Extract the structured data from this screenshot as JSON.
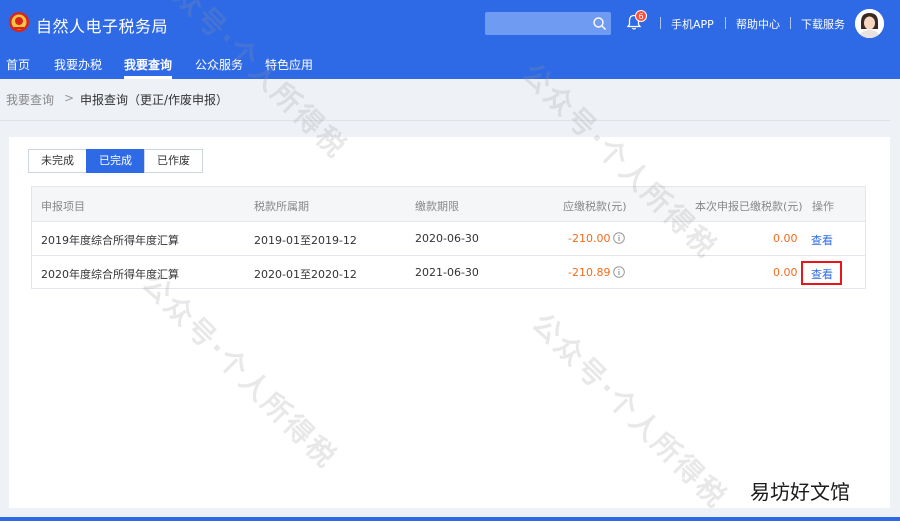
{
  "header": {
    "title": "自然人电子税务局",
    "search_placeholder": "",
    "notification_count": "6",
    "links": [
      "手机APP",
      "帮助中心",
      "下载服务"
    ]
  },
  "nav": {
    "items": [
      "首页",
      "我要办税",
      "我要查询",
      "公众服务",
      "特色应用"
    ],
    "active_index": 2
  },
  "breadcrumb": {
    "parent": "我要查询",
    "separator": ">",
    "current": "申报查询（更正/作废申报）"
  },
  "tabs": {
    "items": [
      "未完成",
      "已完成",
      "已作废"
    ],
    "active_index": 1
  },
  "table": {
    "headers": [
      "申报项目",
      "税款所属期",
      "缴款期限",
      "应缴税款(元)",
      "本次申报已缴税款(元)",
      "操作"
    ],
    "rows": [
      {
        "item": "2019年度综合所得年度汇算",
        "period": "2019-01至2019-12",
        "deadline": "2020-06-30",
        "tax_due": "-210.00",
        "paid": "0.00",
        "action": "查看"
      },
      {
        "item": "2020年度综合所得年度汇算",
        "period": "2020-01至2020-12",
        "deadline": "2021-06-30",
        "tax_due": "-210.89",
        "paid": "0.00",
        "action": "查看"
      }
    ]
  },
  "watermark": {
    "text": "公众号·个人所得税",
    "site": "易坊好文馆"
  },
  "colors": {
    "primary": "#2f6ae6",
    "amount": "#f26b1d",
    "highlight": "#e8151b"
  }
}
